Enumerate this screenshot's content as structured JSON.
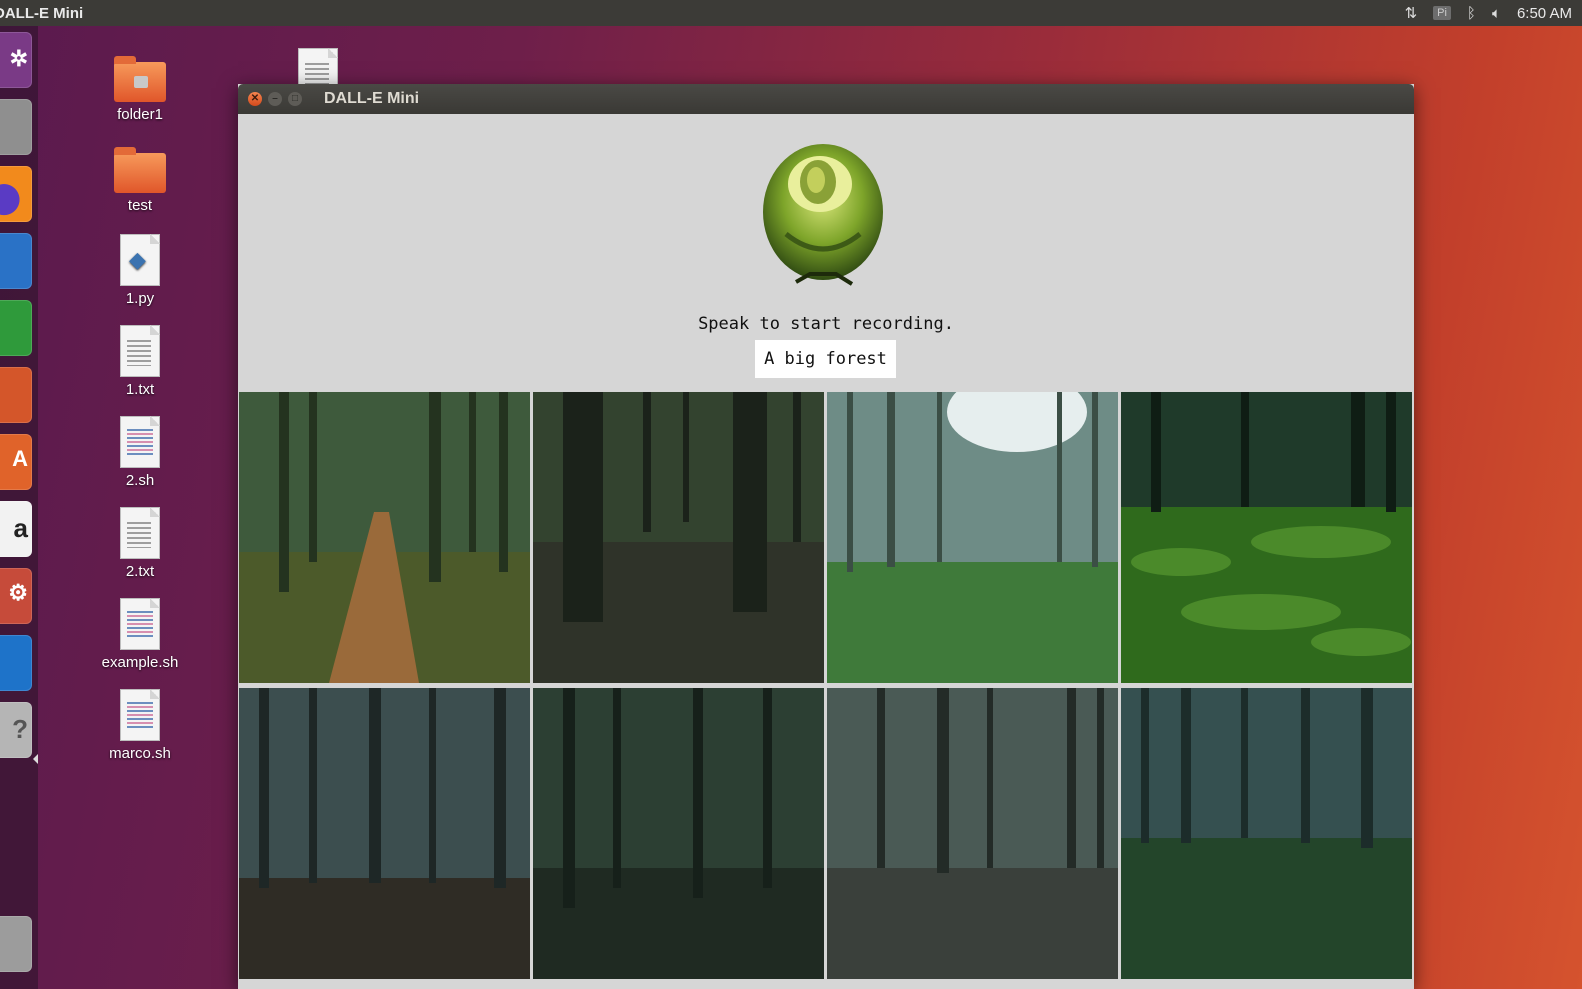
{
  "topbar": {
    "app_name": "DALL-E Mini",
    "clock": "6:50 AM",
    "tray_icons": [
      "network-updown-icon",
      "keyboard-layout-icon",
      "bluetooth-icon",
      "volume-icon"
    ],
    "keyboard_label": "Pi"
  },
  "launcher": {
    "items": [
      "ubuntu-dash-icon",
      "files-icon",
      "firefox-icon",
      "writer-icon",
      "calc-icon",
      "impress-icon",
      "software-center-icon",
      "amazon-icon",
      "settings-icon",
      "vscode-icon",
      "help-icon",
      "trash-icon"
    ],
    "amazon_glyph": "a",
    "help_glyph": "?"
  },
  "desktop": {
    "icons": [
      {
        "label": "folder1",
        "type": "folder-locked"
      },
      {
        "label": "test",
        "type": "folder"
      },
      {
        "label": "1.py",
        "type": "python"
      },
      {
        "label": "1.txt",
        "type": "text"
      },
      {
        "label": "2.sh",
        "type": "script"
      },
      {
        "label": "2.txt",
        "type": "text"
      },
      {
        "label": "example.sh",
        "type": "script"
      },
      {
        "label": "marco.sh",
        "type": "script"
      }
    ]
  },
  "window": {
    "title": "DALL-E Mini",
    "status": "Speak to start recording.",
    "prompt": "A big forest",
    "images": [
      "forest-path-autumn",
      "dark-trunks-leaf-floor",
      "misty-forest-grass-clearing",
      "forest-green-undergrowth",
      "foggy-pine-forest-brown-floor",
      "dark-green-misty-woods",
      "grey-trunks-gravel-floor",
      "teal-pine-forest-grass"
    ]
  }
}
